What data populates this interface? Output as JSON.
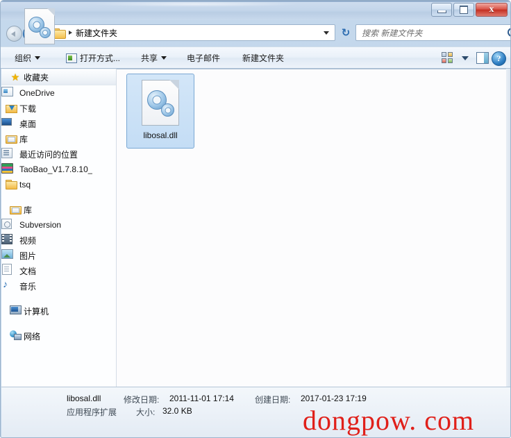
{
  "window": {
    "controls": {
      "minimize": "—",
      "maximize": "❐",
      "close": "x"
    }
  },
  "address_bar": {
    "back_tooltip": "后退",
    "forward_tooltip": "前进",
    "path_text": "新建文件夹",
    "folder_icon": "folder-icon",
    "dropdown_icon": "chevron-down-icon",
    "refresh_icon": "refresh-icon"
  },
  "search": {
    "placeholder": "搜索 新建文件夹",
    "icon": "search-icon"
  },
  "toolbar": {
    "items": [
      {
        "label": "组织",
        "has_caret": true,
        "icon": null
      },
      {
        "label": "打开方式...",
        "has_caret": false,
        "icon": "open-with-icon"
      },
      {
        "label": "共享",
        "has_caret": true,
        "icon": null
      },
      {
        "label": "电子邮件",
        "has_caret": false,
        "icon": null
      },
      {
        "label": "新建文件夹",
        "has_caret": false,
        "icon": null
      }
    ],
    "view_icon": "view-options-icon",
    "view_caret_icon": "chevron-down-icon",
    "preview_icon": "preview-pane-icon",
    "help_icon": "help-icon",
    "help_glyph": "?"
  },
  "navigation_pane": {
    "groups": [
      {
        "header": {
          "label": "收藏夹",
          "icon": "star-icon"
        },
        "items": [
          {
            "label": "OneDrive",
            "icon": "onedrive-icon"
          },
          {
            "label": "下载",
            "icon": "downloads-icon"
          },
          {
            "label": "桌面",
            "icon": "desktop-icon"
          },
          {
            "label": "库",
            "icon": "library-folder-icon"
          },
          {
            "label": "最近访问的位置",
            "icon": "recent-places-icon"
          },
          {
            "label": "TaoBao_V1.7.8.10_",
            "icon": "taobao-icon"
          },
          {
            "label": "tsq",
            "icon": "folder-icon"
          }
        ]
      },
      {
        "header": {
          "label": "库",
          "icon": "library-folder-icon"
        },
        "items": [
          {
            "label": "Subversion",
            "icon": "subversion-icon"
          },
          {
            "label": "视频",
            "icon": "video-icon"
          },
          {
            "label": "图片",
            "icon": "pictures-icon"
          },
          {
            "label": "文档",
            "icon": "documents-icon"
          },
          {
            "label": "音乐",
            "icon": "music-icon"
          }
        ]
      },
      {
        "header": {
          "label": "计算机",
          "icon": "computer-icon"
        },
        "items": []
      },
      {
        "header": {
          "label": "网络",
          "icon": "network-icon"
        },
        "items": []
      }
    ]
  },
  "content": {
    "files": [
      {
        "name": "libosal.dll",
        "icon": "dll-gears-icon",
        "selected": true
      }
    ]
  },
  "details_pane": {
    "icon": "dll-gears-icon",
    "name": "libosal.dll",
    "type": "应用程序扩展",
    "modified_label": "修改日期:",
    "modified_value": "2011-11-01 17:14",
    "size_label": "大小:",
    "size_value": "32.0 KB",
    "created_label": "创建日期:",
    "created_value": "2017-01-23 17:19"
  },
  "watermark": {
    "text": "dongpow. com",
    "color": "#e0201a"
  }
}
